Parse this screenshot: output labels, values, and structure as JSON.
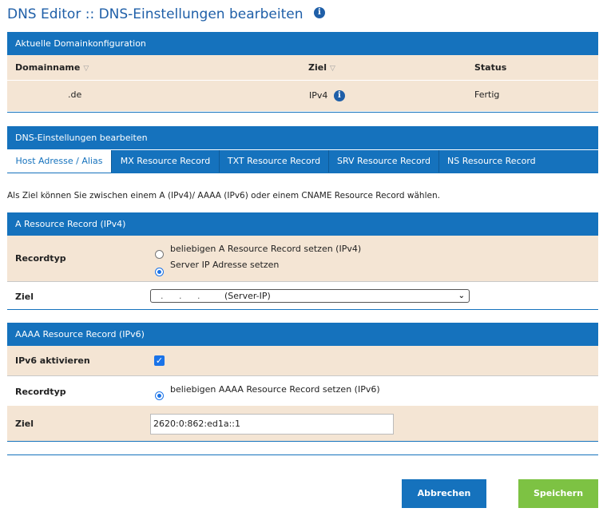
{
  "page": {
    "title": "DNS Editor :: DNS-Einstellungen bearbeiten",
    "info_glyph": "i"
  },
  "current": {
    "header": "Aktuelle Domainkonfiguration",
    "columns": [
      "Domainname",
      "Ziel",
      "Status"
    ],
    "row": {
      "domain": ".de",
      "ziel": "IPv4",
      "status": "Fertig"
    }
  },
  "dns": {
    "header": "DNS-Einstellungen bearbeiten",
    "tabs": [
      "Host Adresse / Alias",
      "MX Resource Record",
      "TXT Resource Record",
      "SRV Resource Record",
      "NS Resource Record"
    ],
    "active_tab": 0,
    "intro": "Als Ziel können Sie zwischen einem A (IPv4)/ AAAA (IPv6) oder einem CNAME Resource Record wählen."
  },
  "a_record": {
    "header": "A Resource Record (IPv4)",
    "recordtyp_label": "Recordtyp",
    "options": [
      "beliebigen A Resource Record setzen (IPv4)",
      "Server IP Adresse setzen"
    ],
    "selected_option": 1,
    "ziel_label": "Ziel",
    "ziel_dots": ". . .",
    "ziel_value": "(Server-IP)"
  },
  "aaaa_record": {
    "header": "AAAA Resource Record (IPv6)",
    "ipv6_label": "IPv6 aktivieren",
    "ipv6_enabled": true,
    "recordtyp_label": "Recordtyp",
    "option": "beliebigen AAAA Resource Record setzen (IPv6)",
    "ziel_label": "Ziel",
    "ziel_value": "2620:0:862:ed1a::1"
  },
  "buttons": {
    "cancel": "Abbrechen",
    "save": "Speichern"
  },
  "colors": {
    "brand_blue": "#1572bd",
    "row_beige": "#f4e5d4",
    "save_green": "#7dc243",
    "title_blue": "#1f5fa8"
  },
  "icons": {
    "info": "info-icon",
    "sort": "sort-triangle-icon",
    "chevron": "chevron-down-icon",
    "check": "checkmark-icon"
  }
}
